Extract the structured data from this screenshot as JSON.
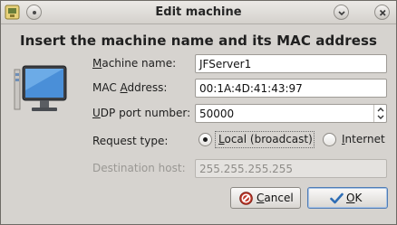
{
  "window": {
    "title": "Edit machine"
  },
  "heading": "Insert the machine name and its MAC address",
  "form": {
    "machine_name": {
      "label_u": "M",
      "label_rest": "achine name:",
      "value": "JFServer1"
    },
    "mac_address": {
      "label_pre": "MAC ",
      "label_u": "A",
      "label_rest": "ddress:",
      "value": "00:1A:4D:41:43:97"
    },
    "udp_port": {
      "label_u": "U",
      "label_rest": "DP port number:",
      "value": "50000"
    },
    "request_type": {
      "label": "Request type:",
      "options": [
        {
          "label_u": "L",
          "label_rest": "ocal (broadcast)",
          "selected": true
        },
        {
          "label_u": "I",
          "label_rest": "nternet",
          "selected": false
        }
      ]
    },
    "destination_host": {
      "label": "Destination host:",
      "value": "255.255.255.255",
      "enabled": false
    }
  },
  "buttons": {
    "cancel": {
      "label_u": "C",
      "label_rest": "ancel"
    },
    "ok": {
      "label_u": "O",
      "label_rest": "K"
    }
  },
  "colors": {
    "dialog_bg": "#d6d3cf",
    "cancel_icon": "#c0392b",
    "ok_icon": "#2d6db5"
  }
}
